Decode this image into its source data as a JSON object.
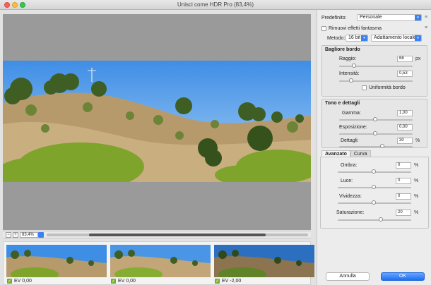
{
  "window": {
    "title": "Unisci come HDR Pro (83,4%)"
  },
  "zoom": {
    "value": "83,4%"
  },
  "thumbnails": [
    {
      "label": "EV 0,00"
    },
    {
      "label": "EV 0,00"
    },
    {
      "label": "EV -2,00"
    }
  ],
  "panel": {
    "preset_label": "Predefinito:",
    "preset_value": "Personale",
    "ghost_label": "Rimuovi effetti fantasma",
    "method_label": "Metodo:",
    "bits_value": "16 bit",
    "method_value": "Adattamento locale",
    "edge_glow": {
      "title": "Bagliore bordo",
      "radius_label": "Raggio:",
      "radius_value": "68",
      "radius_unit": "px",
      "strength_label": "Intensità:",
      "strength_value": "0,53",
      "smooth_label": "Uniformità bordo"
    },
    "tone_detail": {
      "title": "Tono e dettagli",
      "gamma_label": "Gamma:",
      "gamma_value": "1,00",
      "exposure_label": "Esposizione:",
      "exposure_value": "0,00",
      "detail_label": "Dettagli:",
      "detail_value": "30",
      "detail_unit": "%"
    },
    "tabs": {
      "advanced": "Avanzato",
      "curve": "Curva"
    },
    "advanced": {
      "shadow_label": "Ombra:",
      "shadow_value": "0",
      "highlight_label": "Luce:",
      "highlight_value": "0",
      "vibrance_label": "Vividezza:",
      "vibrance_value": "0",
      "saturation_label": "Saturazione:",
      "saturation_value": "20",
      "unit": "%"
    },
    "cancel_label": "Annulla",
    "ok_label": "OK"
  },
  "colors": {
    "accent": "#3b82f0",
    "ok_button": "#1d6ff2",
    "check": "#7fb23c"
  }
}
